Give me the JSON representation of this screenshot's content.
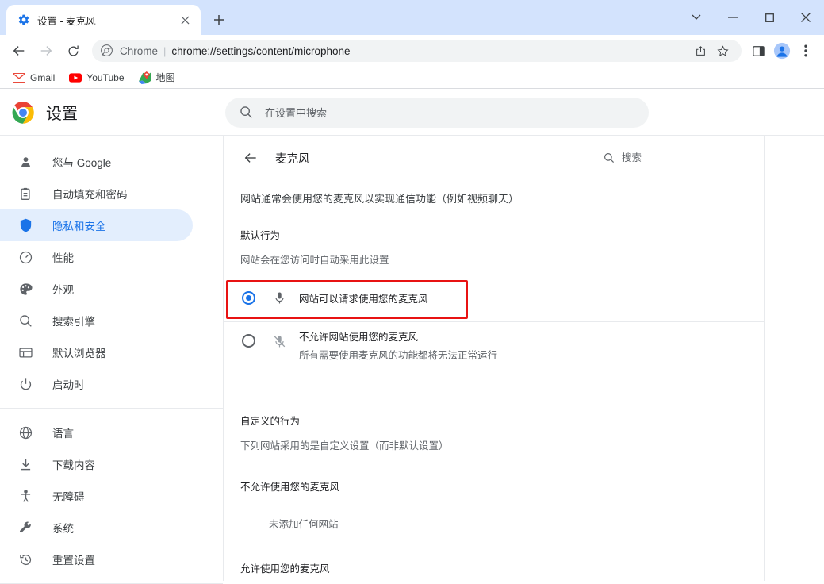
{
  "window": {
    "tab": {
      "title": "设置 - 麦克风",
      "favicon": "gear-icon",
      "close_label": "✕"
    },
    "new_tab_label": "+",
    "controls": {
      "tab_search": "⌄",
      "minimize": "—",
      "maximize": "▢",
      "close": "✕"
    }
  },
  "toolbar": {
    "back": "←",
    "forward": "→",
    "reload": "⟳",
    "omnibox": {
      "security_icon": "chrome-logo-icon",
      "scheme_label": "Chrome",
      "separator": "|",
      "url": "chrome://settings/content/microphone",
      "share_icon": "share-icon",
      "bookmark_icon": "star-icon"
    },
    "side_panel_icon": "side-panel-icon",
    "profile_icon": "profile-avatar-icon",
    "menu_icon": "three-dot-menu-icon"
  },
  "bookmarks": [
    {
      "label": "Gmail",
      "icon": "gmail-icon"
    },
    {
      "label": "YouTube",
      "icon": "youtube-icon"
    },
    {
      "label": "地图",
      "icon": "maps-icon"
    }
  ],
  "settings_header": {
    "logo": "chrome-logo-icon",
    "title": "设置",
    "search_icon": "search-icon",
    "search_placeholder": "在设置中搜索",
    "search_value": ""
  },
  "sidebar": {
    "groups": [
      {
        "items": [
          {
            "label": "您与 Google",
            "icon": "person-icon",
            "active": false
          },
          {
            "label": "自动填充和密码",
            "icon": "clipboard-icon",
            "active": false
          },
          {
            "label": "隐私和安全",
            "icon": "shield-icon",
            "active": true
          },
          {
            "label": "性能",
            "icon": "speedometer-icon",
            "active": false
          },
          {
            "label": "外观",
            "icon": "palette-icon",
            "active": false
          },
          {
            "label": "搜索引擎",
            "icon": "search-icon",
            "active": false
          },
          {
            "label": "默认浏览器",
            "icon": "browser-window-icon",
            "active": false
          },
          {
            "label": "启动时",
            "icon": "power-icon",
            "active": false
          }
        ]
      },
      {
        "items": [
          {
            "label": "语言",
            "icon": "globe-icon",
            "active": false
          },
          {
            "label": "下载内容",
            "icon": "download-icon",
            "active": false
          },
          {
            "label": "无障碍",
            "icon": "accessibility-icon",
            "active": false
          },
          {
            "label": "系统",
            "icon": "wrench-icon",
            "active": false
          },
          {
            "label": "重置设置",
            "icon": "history-restore-icon",
            "active": false
          }
        ]
      }
    ]
  },
  "content": {
    "back_icon": "back-arrow-icon",
    "title": "麦克风",
    "search_icon": "search-icon",
    "search_placeholder": "搜索",
    "search_value": "",
    "description": "网站通常会使用您的麦克风以实现通信功能（例如视频聊天）",
    "default_behavior": {
      "title": "默认行为",
      "subtitle": "网站会在您访问时自动采用此设置",
      "options": [
        {
          "label": "网站可以请求使用您的麦克风",
          "sublabel": "",
          "icon": "microphone-icon",
          "selected": true,
          "highlighted": true
        },
        {
          "label": "不允许网站使用您的麦克风",
          "sublabel": "所有需要使用麦克风的功能都将无法正常运行",
          "icon": "microphone-muted-icon",
          "selected": false,
          "highlighted": false
        }
      ]
    },
    "custom_behavior": {
      "title": "自定义的行为",
      "subtitle": "下列网站采用的是自定义设置（而非默认设置）",
      "blocked_title": "不允许使用您的麦克风",
      "blocked_empty": "未添加任何网站",
      "allowed_title": "允许使用您的麦克风"
    }
  },
  "colors": {
    "accent": "#1a73e8",
    "tabstrip": "#d3e3fd",
    "active_nav_bg": "#e3eefd",
    "highlight_border": "#e81313"
  }
}
